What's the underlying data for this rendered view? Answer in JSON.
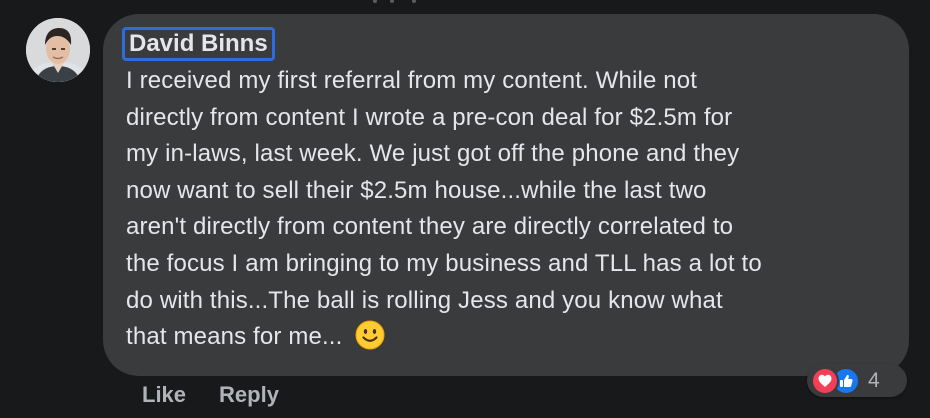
{
  "comment": {
    "author": "David Binns",
    "text_lines": [
      "I received my first referral from my content. While not",
      "directly from content I wrote a pre-con deal for $2.5m for",
      "my in-laws, last week. We just got off the phone and they",
      "now want to sell their $2.5m house...while the last two",
      "aren't directly from content they are directly correlated to",
      "the focus I am bringing to my business and TLL has a lot to",
      "do with this...The ball is rolling Jess and you know what",
      "that means for me..."
    ],
    "emoji": "slightly-smiling-face-icon"
  },
  "actions": {
    "like_label": "Like",
    "reply_label": "Reply"
  },
  "reactions": {
    "icons": [
      "love-reaction-icon",
      "like-reaction-icon"
    ],
    "count": "4"
  },
  "colors": {
    "background": "#18191a",
    "bubble": "#3a3b3c",
    "text": "#e4e6eb",
    "secondary_text": "#b0b3b8",
    "focus_outline": "#2d6cdf",
    "love": "#f33e58",
    "like": "#1877f2"
  }
}
